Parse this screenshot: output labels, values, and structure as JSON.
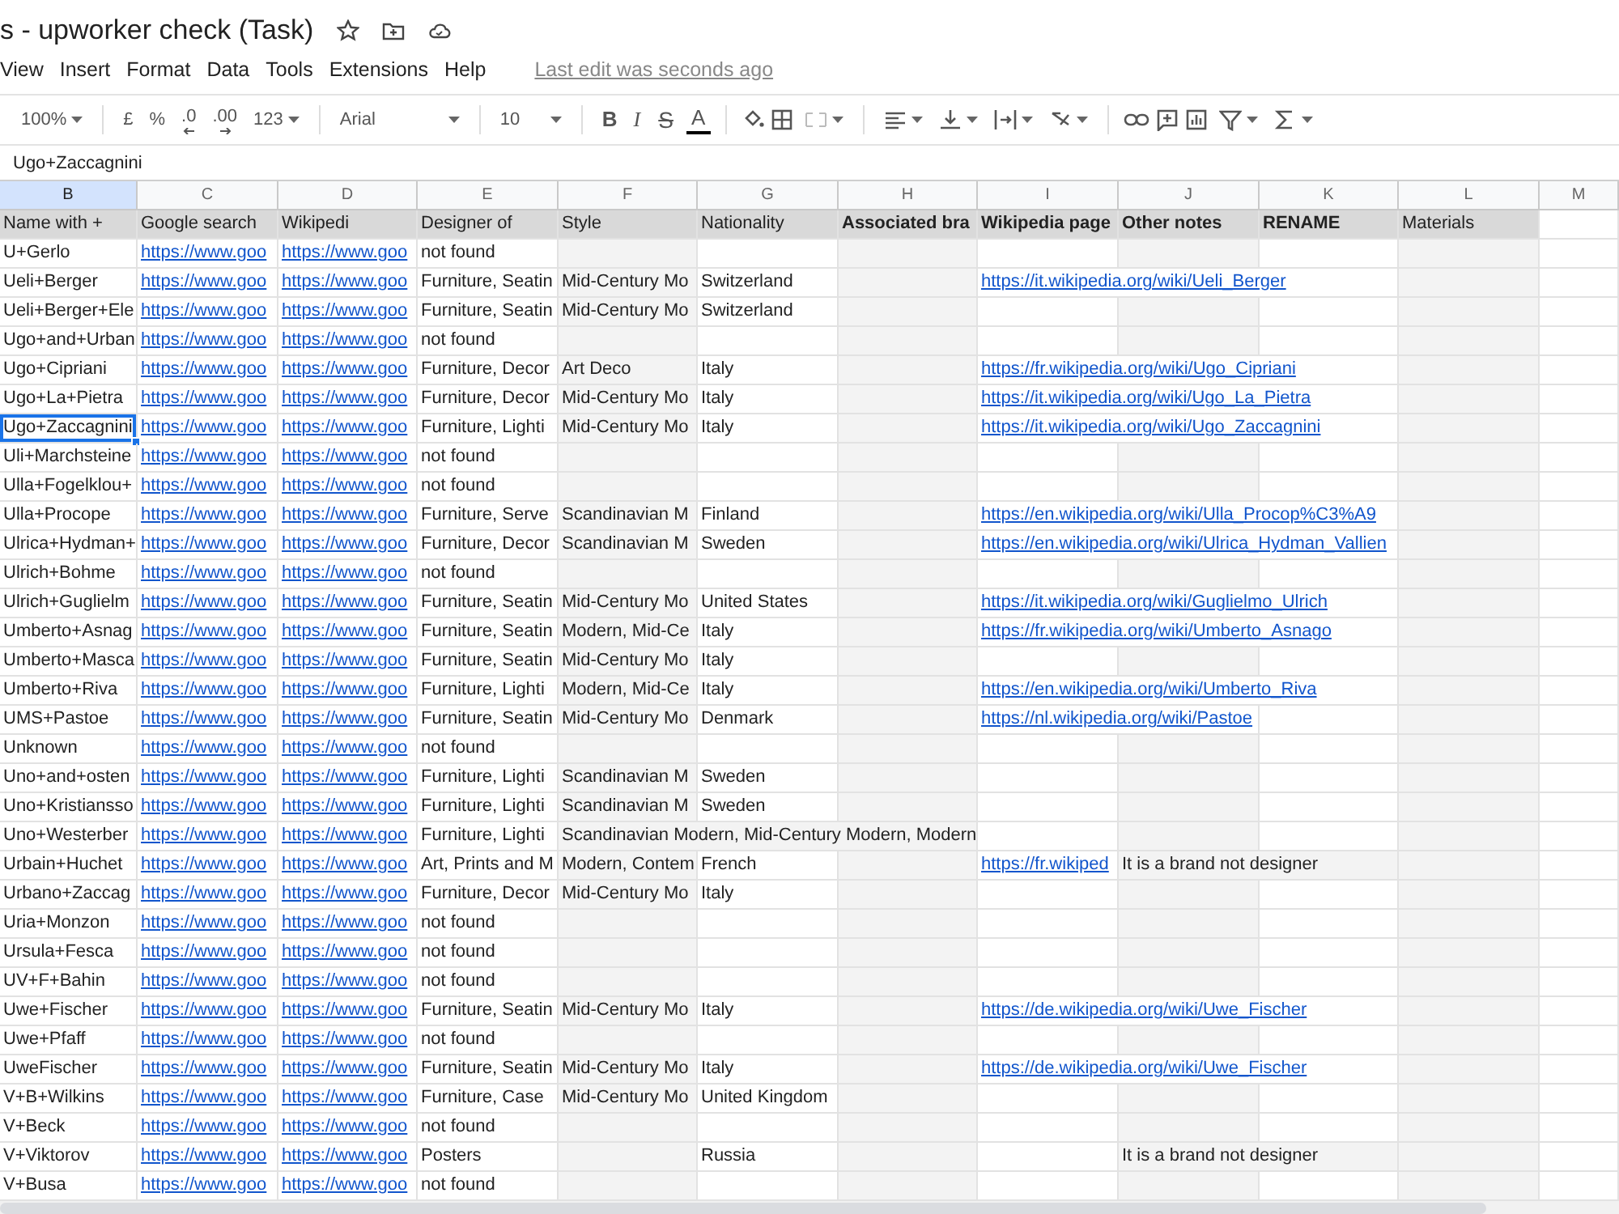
{
  "document_title": "s - upworker check (Task)",
  "menu": [
    "View",
    "Insert",
    "Format",
    "Data",
    "Tools",
    "Extensions",
    "Help"
  ],
  "last_edit": "Last edit was seconds ago",
  "toolbar": {
    "zoom": "100%",
    "currency": "£",
    "percent": "%",
    "decimal_decrease": ".0",
    "decimal_increase": ".00",
    "number_format": "123",
    "font": "Arial",
    "font_size": "10",
    "bold": "B",
    "italic": "I",
    "strikethrough": "S",
    "text_color": "A"
  },
  "formula_bar": {
    "value": "Ugo+Zaccagnini"
  },
  "columns": [
    {
      "letter": "B",
      "heading": "Name with +",
      "selected": true
    },
    {
      "letter": "C",
      "heading": "Google search",
      "selected": false,
      "links": true
    },
    {
      "letter": "D",
      "heading": "Wikipedi",
      "selected": false,
      "links": true
    },
    {
      "letter": "E",
      "heading": "Designer of",
      "selected": false
    },
    {
      "letter": "F",
      "heading": "Style",
      "selected": false,
      "shaded": true
    },
    {
      "letter": "G",
      "heading": "Nationality",
      "selected": false
    },
    {
      "letter": "H",
      "heading": "Associated bra",
      "selected": false,
      "bold": true,
      "shaded": true
    },
    {
      "letter": "I",
      "heading": "Wikipedia page",
      "selected": false,
      "bold": true,
      "links": true
    },
    {
      "letter": "J",
      "heading": "Other notes",
      "selected": false,
      "bold": true,
      "shaded": true
    },
    {
      "letter": "K",
      "heading": "RENAME",
      "selected": false,
      "bold": true
    },
    {
      "letter": "L",
      "heading": "Materials",
      "selected": false,
      "shaded": true
    },
    {
      "letter": "M",
      "selected": false
    }
  ],
  "rows": [
    {
      "selected": false,
      "B": "U+Gerlo",
      "C": "https://www.goo",
      "D": "https://www.goo",
      "E": "not found"
    },
    {
      "selected": false,
      "B": "Ueli+Berger",
      "C": "https://www.goo",
      "D": "https://www.goo",
      "E": "Furniture, Seatin",
      "F": "Mid-Century Mo",
      "G": "Switzerland",
      "I": "https://it.wikipedia.org/wiki/Ueli_Berger"
    },
    {
      "selected": false,
      "B": "Ueli+Berger+Ele",
      "C": "https://www.goo",
      "D": "https://www.goo",
      "E": "Furniture, Seatin",
      "F": "Mid-Century Mo",
      "G": "Switzerland"
    },
    {
      "selected": false,
      "B": "Ugo+and+Urban",
      "C": "https://www.goo",
      "D": "https://www.goo",
      "E": "not found"
    },
    {
      "selected": false,
      "B": "Ugo+Cipriani",
      "C": "https://www.goo",
      "D": "https://www.goo",
      "E": "Furniture, Decor",
      "F": "Art Deco",
      "G": "Italy",
      "I": "https://fr.wikipedia.org/wiki/Ugo_Cipriani"
    },
    {
      "selected": false,
      "B": "Ugo+La+Pietra",
      "C": "https://www.goo",
      "D": "https://www.goo",
      "E": "Furniture, Decor",
      "F": "Mid-Century Mo",
      "G": "Italy",
      "I": "https://it.wikipedia.org/wiki/Ugo_La_Pietra"
    },
    {
      "selected": true,
      "B": "Ugo+Zaccagnini",
      "C": "https://www.goo",
      "D": "https://www.goo",
      "E": "Furniture, Lighti",
      "F": "Mid-Century Mo",
      "G": "Italy",
      "I": "https://it.wikipedia.org/wiki/Ugo_Zaccagnini"
    },
    {
      "selected": false,
      "B": "Uli+Marchsteine",
      "C": "https://www.goo",
      "D": "https://www.goo",
      "E": "not found"
    },
    {
      "selected": false,
      "B": "Ulla+Fogelklou+",
      "C": "https://www.goo",
      "D": "https://www.goo",
      "E": "not found"
    },
    {
      "selected": false,
      "B": "Ulla+Procope",
      "C": "https://www.goo",
      "D": "https://www.goo",
      "E": "Furniture, Serve",
      "F": "Scandinavian M",
      "G": "Finland",
      "I": "https://en.wikipedia.org/wiki/Ulla_Procop%C3%A9"
    },
    {
      "selected": false,
      "B": "Ulrica+Hydman+",
      "C": "https://www.goo",
      "D": "https://www.goo",
      "E": "Furniture, Decor",
      "F": "Scandinavian M",
      "G": "Sweden",
      "I": "https://en.wikipedia.org/wiki/Ulrica_Hydman_Vallien"
    },
    {
      "selected": false,
      "B": "Ulrich+Bohme",
      "C": "https://www.goo",
      "D": "https://www.goo",
      "E": "not found"
    },
    {
      "selected": false,
      "B": "Ulrich+Guglielm",
      "C": "https://www.goo",
      "D": "https://www.goo",
      "E": "Furniture, Seatin",
      "F": "Mid-Century Mo",
      "G": "United States",
      "I": "https://it.wikipedia.org/wiki/Guglielmo_Ulrich"
    },
    {
      "selected": false,
      "B": "Umberto+Asnag",
      "C": "https://www.goo",
      "D": "https://www.goo",
      "E": "Furniture, Seatin",
      "F": "Modern, Mid-Ce",
      "G": "Italy",
      "I": "https://fr.wikipedia.org/wiki/Umberto_Asnago"
    },
    {
      "selected": false,
      "B": "Umberto+Masca",
      "C": "https://www.goo",
      "D": "https://www.goo",
      "E": "Furniture, Seatin",
      "F": "Mid-Century Mo",
      "G": "Italy"
    },
    {
      "selected": false,
      "B": "Umberto+Riva",
      "C": "https://www.goo",
      "D": "https://www.goo",
      "E": "Furniture, Lighti",
      "F": "Modern, Mid-Ce",
      "G": "Italy",
      "I": "https://en.wikipedia.org/wiki/Umberto_Riva"
    },
    {
      "selected": false,
      "B": "UMS+Pastoe",
      "C": "https://www.goo",
      "D": "https://www.goo",
      "E": "Furniture, Seatin",
      "F": "Mid-Century Mo",
      "G": "Denmark",
      "I": "https://nl.wikipedia.org/wiki/Pastoe"
    },
    {
      "selected": false,
      "B": "Unknown",
      "C": "https://www.goo",
      "D": "https://www.goo",
      "E": "not found"
    },
    {
      "selected": false,
      "B": "Uno+and+osten",
      "C": "https://www.goo",
      "D": "https://www.goo",
      "E": "Furniture, Lighti",
      "F": "Scandinavian M",
      "G": "Sweden"
    },
    {
      "selected": false,
      "B": "Uno+Kristiansso",
      "C": "https://www.goo",
      "D": "https://www.goo",
      "E": "Furniture, Lighti",
      "F": "Scandinavian M",
      "G": "Sweden"
    },
    {
      "selected": false,
      "B": "Uno+Westerber",
      "C": "https://www.goo",
      "D": "https://www.goo",
      "E": "Furniture, Lighti",
      "F": "Scandinavian Modern, Mid-Century Modern, Modern"
    },
    {
      "selected": false,
      "B": "Urbain+Huchet",
      "C": "https://www.goo",
      "D": "https://www.goo",
      "E": "Art, Prints and M",
      "F": "Modern, Contem",
      "G": "French",
      "I": "https://fr.wikiped",
      "J": "It is a brand not designer"
    },
    {
      "selected": false,
      "B": "Urbano+Zaccag",
      "C": "https://www.goo",
      "D": "https://www.goo",
      "E": "Furniture, Decor",
      "F": "Mid-Century Mo",
      "G": "Italy"
    },
    {
      "selected": false,
      "B": "Uria+Monzon",
      "C": "https://www.goo",
      "D": "https://www.goo",
      "E": "not found"
    },
    {
      "selected": false,
      "B": "Ursula+Fesca",
      "C": "https://www.goo",
      "D": "https://www.goo",
      "E": "not found"
    },
    {
      "selected": false,
      "B": "UV+F+Bahin",
      "C": "https://www.goo",
      "D": "https://www.goo",
      "E": "not found"
    },
    {
      "selected": false,
      "B": "Uwe+Fischer",
      "C": "https://www.goo",
      "D": "https://www.goo",
      "E": "Furniture, Seatin",
      "F": "Mid-Century Mo",
      "G": "Italy",
      "I": "https://de.wikipedia.org/wiki/Uwe_Fischer"
    },
    {
      "selected": false,
      "B": "Uwe+Pfaff",
      "C": "https://www.goo",
      "D": "https://www.goo",
      "E": "not found"
    },
    {
      "selected": false,
      "B": "UweFischer",
      "C": "https://www.goo",
      "D": "https://www.goo",
      "E": "Furniture, Seatin",
      "F": "Mid-Century Mo",
      "G": "Italy",
      "I": "https://de.wikipedia.org/wiki/Uwe_Fischer"
    },
    {
      "selected": false,
      "B": "V+B+Wilkins",
      "C": "https://www.goo",
      "D": "https://www.goo",
      "E": "Furniture, Case",
      "F": "Mid-Century Mo",
      "G": "United Kingdom"
    },
    {
      "selected": false,
      "B": "V+Beck",
      "C": "https://www.goo",
      "D": "https://www.goo",
      "E": "not found"
    },
    {
      "selected": false,
      "B": "V+Viktorov",
      "C": "https://www.goo",
      "D": "https://www.goo",
      "E": "Posters",
      "G": "Russia",
      "J": "It is a brand not designer"
    },
    {
      "selected": false,
      "B": "V+Busa",
      "C": "https://www.goo",
      "D": "https://www.goo",
      "E": "not found"
    }
  ]
}
